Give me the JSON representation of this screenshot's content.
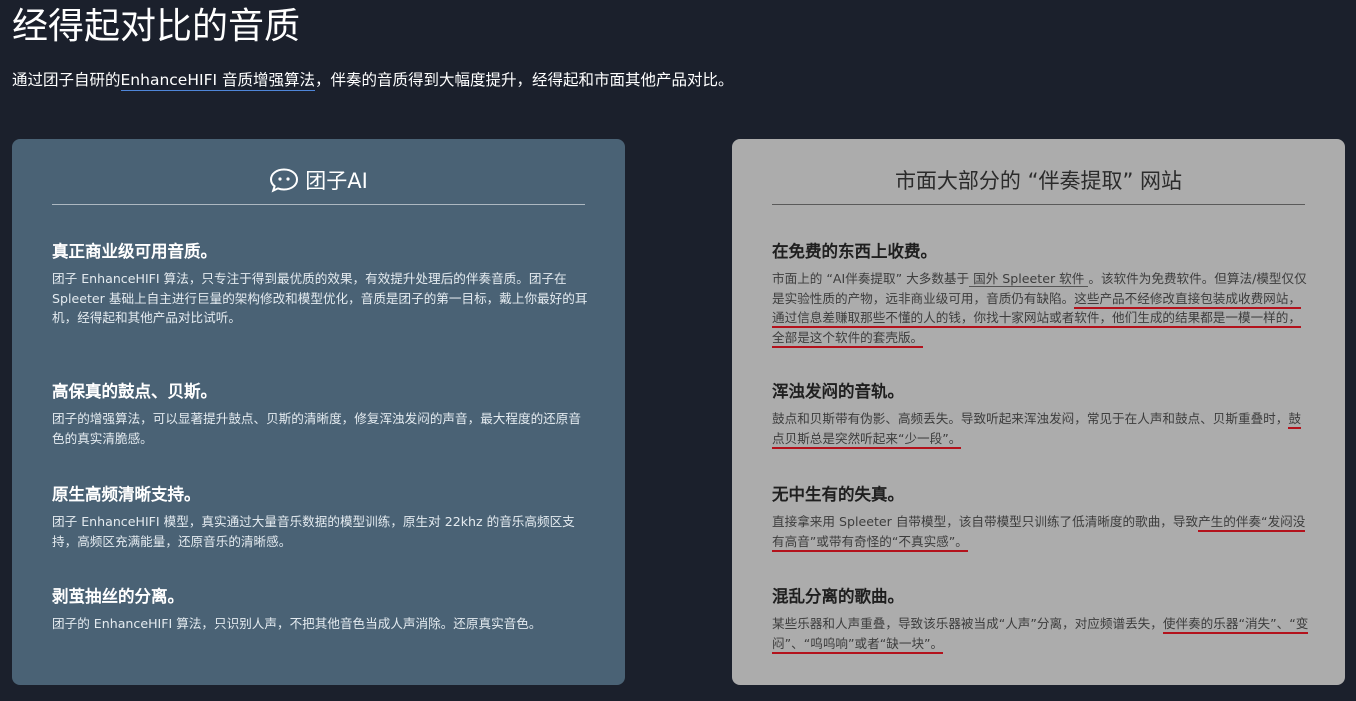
{
  "header": {
    "title": "经得起对比的音质",
    "subtitle_prefix": "通过团子自研的",
    "subtitle_link": "EnhanceHIFI 音质增强算法",
    "subtitle_suffix": "，伴奏的音质得到大幅度提升，经得起和市面其他产品对比。"
  },
  "left_card": {
    "title": "团子AI",
    "icon": "smiley-chat-icon",
    "features": [
      {
        "heading": "真正商业级可用音质。",
        "body": "团子 EnhanceHIFI 算法，只专注于得到最优质的效果，有效提升处理后的伴奏音质。团子在 Spleeter 基础上自主进行巨量的架构修改和模型优化，音质是团子的第一目标，戴上你最好的耳机，经得起和其他产品对比试听。"
      },
      {
        "heading": "高保真的鼓点、贝斯。",
        "body": "团子的增强算法，可以显著提升鼓点、贝斯的清晰度，修复浑浊发闷的声音，最大程度的还原音色的真实清脆感。"
      },
      {
        "heading": "原生高频清晰支持。",
        "body": "团子 EnhanceHIFI 模型，真实通过大量音乐数据的模型训练，原生对 22khz 的音乐高频区支持，高频区充满能量，还原音乐的清晰感。"
      },
      {
        "heading": "剥茧抽丝的分离。",
        "body": "团子的 EnhanceHIFI 算法，只识别人声，不把其他音色当成人声消除。还原真实音色。"
      }
    ]
  },
  "right_card": {
    "title": "市面大部分的 “伴奏提取” 网站",
    "features": [
      {
        "heading": "在免费的东西上收费。",
        "body_1": "市面上的 “AI伴奏提取” 大多数基于",
        "body_link": " 国外 Spleeter 软件 ",
        "body_2": "。该软件为免费软件。但算法/模型仅仅是实验性质的产物，远非商业级可用，音质仍有缺陷。",
        "body_emph": "这些产品不经修改直接包装成收费网站，通过信息差赚取那些不懂的人的钱，你找十家网站或者软件，他们生成的结果都是一模一样的，全部是这个软件的套壳版。"
      },
      {
        "heading": "浑浊发闷的音轨。",
        "body_1": "鼓点和贝斯带有伪影、高频丢失。导致听起来浑浊发闷，常见于在人声和鼓点、贝斯重叠时，",
        "body_emph": "鼓点贝斯总是突然听起来“少一段”。"
      },
      {
        "heading": "无中生有的失真。",
        "body_1": "直接拿来用 Spleeter 自带模型，该自带模型只训练了低清晰度的歌曲，导致",
        "body_emph": "产生的伴奏“发闷没有高音”或带有奇怪的“不真实感”。"
      },
      {
        "heading": "混乱分离的歌曲。",
        "body_1": "某些乐器和人声重叠，导致该乐器被当成“人声”分离，对应频谱丢失，",
        "body_emph": "使伴奏的乐器“消失”、“变闷”、“呜呜响”或者“缺一块”。"
      }
    ]
  },
  "colors": {
    "page_bg": "#1b202c",
    "left_card_bg": "#4a6275",
    "right_card_bg": "#acacac",
    "underline_red": "#b3121c",
    "link_underline": "#4f86d9"
  }
}
